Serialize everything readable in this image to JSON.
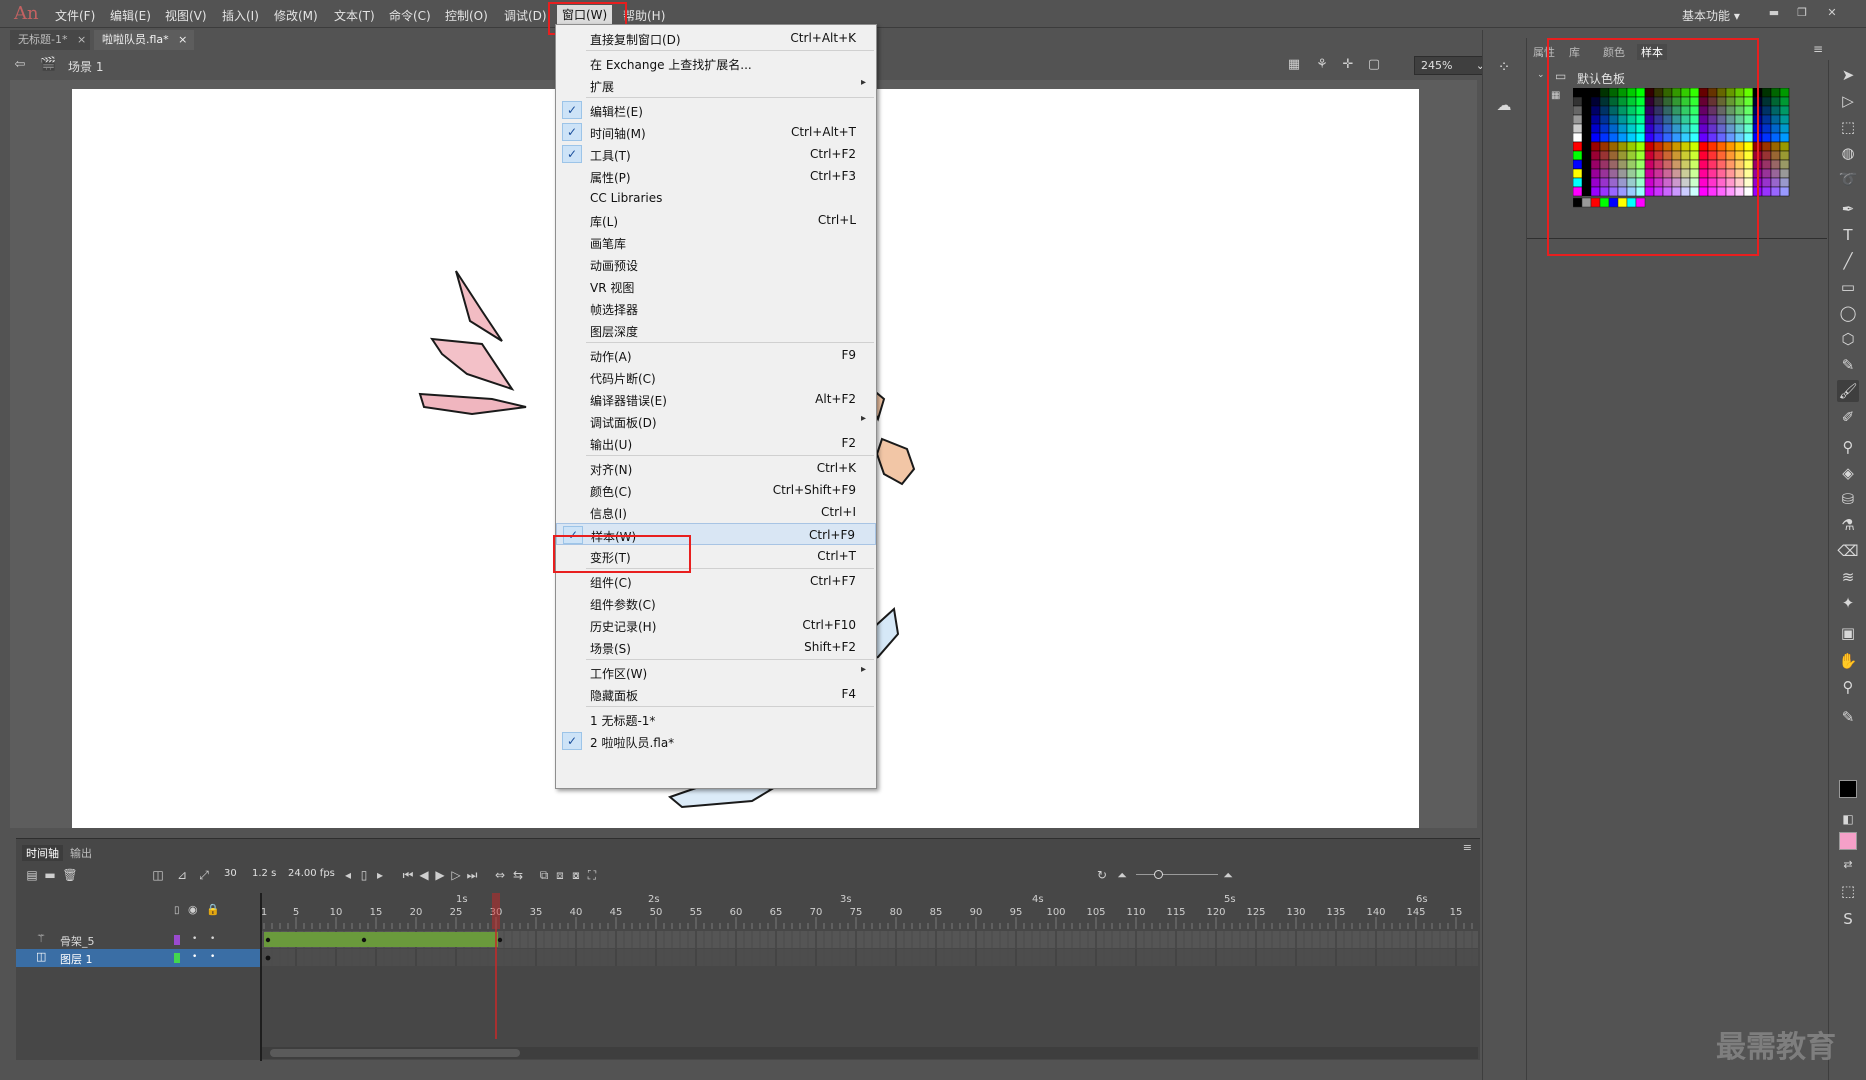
{
  "app": {
    "logo": "An"
  },
  "menus": [
    "文件(F)",
    "编辑(E)",
    "视图(V)",
    "插入(I)",
    "修改(M)",
    "文本(T)",
    "命令(C)",
    "控制(O)",
    "调试(D)",
    "窗口(W)",
    "帮助(H)"
  ],
  "workspace_label": "基本功能",
  "doc_tabs": [
    {
      "label": "无标题-1*",
      "close": "×"
    },
    {
      "label": "啦啦队员.fla*",
      "close": "×"
    }
  ],
  "edit_bar": {
    "scene": "场景 1",
    "zoom": "245%"
  },
  "window_menu": {
    "items": [
      {
        "label": "直接复制窗口(D)",
        "shortcut": "Ctrl+Alt+K",
        "checked": false,
        "submenu": false
      },
      {
        "label": "在 Exchange 上查找扩展名...",
        "shortcut": "",
        "checked": false,
        "submenu": false
      },
      {
        "label": "扩展",
        "shortcut": "",
        "checked": false,
        "submenu": true
      },
      {
        "label": "编辑栏(E)",
        "shortcut": "",
        "checked": true,
        "submenu": false
      },
      {
        "label": "时间轴(M)",
        "shortcut": "Ctrl+Alt+T",
        "checked": true,
        "submenu": false
      },
      {
        "label": "工具(T)",
        "shortcut": "Ctrl+F2",
        "checked": true,
        "submenu": false
      },
      {
        "label": "属性(P)",
        "shortcut": "Ctrl+F3",
        "checked": false,
        "submenu": false
      },
      {
        "label": "CC Libraries",
        "shortcut": "",
        "checked": false,
        "submenu": false
      },
      {
        "label": "库(L)",
        "shortcut": "Ctrl+L",
        "checked": false,
        "submenu": false
      },
      {
        "label": "画笔库",
        "shortcut": "",
        "checked": false,
        "submenu": false
      },
      {
        "label": "动画预设",
        "shortcut": "",
        "checked": false,
        "submenu": false
      },
      {
        "label": "VR 视图",
        "shortcut": "",
        "checked": false,
        "submenu": false
      },
      {
        "label": "帧选择器",
        "shortcut": "",
        "checked": false,
        "submenu": false
      },
      {
        "label": "图层深度",
        "shortcut": "",
        "checked": false,
        "submenu": false
      },
      {
        "label": "动作(A)",
        "shortcut": "F9",
        "checked": false,
        "submenu": false
      },
      {
        "label": "代码片断(C)",
        "shortcut": "",
        "checked": false,
        "submenu": false
      },
      {
        "label": "编译器错误(E)",
        "shortcut": "Alt+F2",
        "checked": false,
        "submenu": false
      },
      {
        "label": "调试面板(D)",
        "shortcut": "",
        "checked": false,
        "submenu": true
      },
      {
        "label": "输出(U)",
        "shortcut": "F2",
        "checked": false,
        "submenu": false
      },
      {
        "label": "对齐(N)",
        "shortcut": "Ctrl+K",
        "checked": false,
        "submenu": false
      },
      {
        "label": "颜色(C)",
        "shortcut": "Ctrl+Shift+F9",
        "checked": false,
        "submenu": false
      },
      {
        "label": "信息(I)",
        "shortcut": "Ctrl+I",
        "checked": false,
        "submenu": false
      },
      {
        "label": "样本(W)",
        "shortcut": "Ctrl+F9",
        "checked": true,
        "submenu": false
      },
      {
        "label": "变形(T)",
        "shortcut": "Ctrl+T",
        "checked": false,
        "submenu": false
      },
      {
        "label": "组件(C)",
        "shortcut": "Ctrl+F7",
        "checked": false,
        "submenu": false
      },
      {
        "label": "组件参数(C)",
        "shortcut": "",
        "checked": false,
        "submenu": false
      },
      {
        "label": "历史记录(H)",
        "shortcut": "Ctrl+F10",
        "checked": false,
        "submenu": false
      },
      {
        "label": "场景(S)",
        "shortcut": "Shift+F2",
        "checked": false,
        "submenu": false
      },
      {
        "label": "工作区(W)",
        "shortcut": "",
        "checked": false,
        "submenu": true
      },
      {
        "label": "隐藏面板",
        "shortcut": "F4",
        "checked": false,
        "submenu": false
      },
      {
        "label": "1 无标题-1*",
        "shortcut": "",
        "checked": false,
        "submenu": false
      },
      {
        "label": "2 啦啦队员.fla*",
        "shortcut": "",
        "checked": true,
        "submenu": false
      }
    ]
  },
  "right_panel": {
    "tabs": [
      "属性",
      "库",
      "颜色",
      "样本"
    ],
    "palette_name": "默认色板"
  },
  "timeline": {
    "tabs": [
      "时间轴",
      "输出"
    ],
    "current_frame": "30",
    "time": "1.2 s",
    "fps": "24.00 fps",
    "seconds": [
      "1s",
      "2s",
      "3s",
      "4s",
      "5s",
      "6s"
    ],
    "frame_numbers": [
      "1",
      "5",
      "10",
      "15",
      "20",
      "25",
      "30",
      "35",
      "40",
      "45",
      "50",
      "55",
      "60",
      "65",
      "70",
      "75",
      "80",
      "85",
      "90",
      "95",
      "100",
      "105",
      "110",
      "115",
      "120",
      "125",
      "130",
      "135",
      "140",
      "145",
      "15"
    ],
    "layers": [
      {
        "name": "骨架_5",
        "color": "#9a4ad0"
      },
      {
        "name": "图层 1",
        "color": "#43d64e"
      }
    ]
  },
  "watermark": "最需教育",
  "colors": {
    "accent_red": "#e81f1f",
    "menu_bg": "#f0f0f0",
    "chrome": "#535353",
    "layer_selected": "#3a6ea5",
    "span_green": "#6a9a3c"
  }
}
